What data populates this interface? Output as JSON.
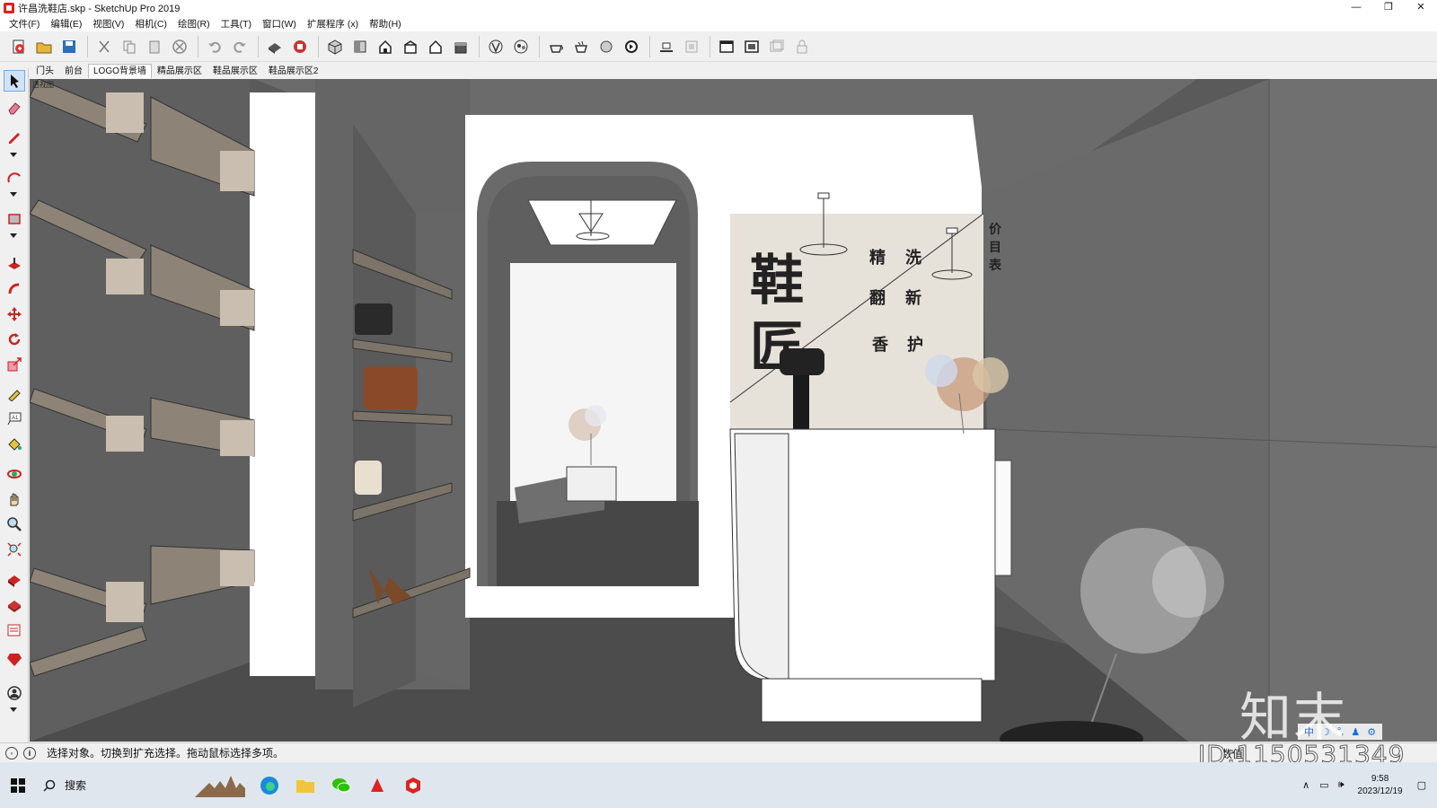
{
  "window": {
    "title": "许昌洗鞋店.skp - SketchUp Pro 2019",
    "controls": [
      "minimize",
      "restore",
      "close"
    ]
  },
  "menu": [
    "文件(F)",
    "编辑(E)",
    "视图(V)",
    "相机(C)",
    "绘图(R)",
    "工具(T)",
    "窗口(W)",
    "扩展程序 (x)",
    "帮助(H)"
  ],
  "toolbar_icons": [
    "new-file-icon",
    "open-folder-icon",
    "save-icon",
    "cut-icon",
    "copy-icon",
    "paste-icon",
    "erase-icon",
    "undo-icon",
    "redo-icon",
    "print-icon",
    "model-info-icon",
    "iso-view-icon",
    "top-view-icon",
    "front-view-icon",
    "right-view-icon",
    "back-view-icon",
    "left-view-icon",
    "xray-icon",
    "back-edges-icon",
    "wireframe-icon",
    "hidden-line-icon",
    "shaded-icon",
    "shaded-texture-icon",
    "section-plane-icon",
    "section-display-icon",
    "warehouse-icon",
    "extension-warehouse-icon",
    "layout-icon",
    "lock-icon"
  ],
  "scenes": {
    "tabs": [
      "门头",
      "前台",
      "LOGO背景墙",
      "精品展示区",
      "鞋品展示区",
      "鞋品展示区2"
    ],
    "active_index": 2
  },
  "viewport": {
    "view_label": "透视图",
    "sign": {
      "big_chars": [
        "鞋",
        "匠"
      ],
      "small_chars": [
        "精",
        "洗",
        "翻",
        "新",
        "香",
        "护"
      ],
      "side_text": "价目表"
    }
  },
  "left_tools": [
    "select-arrow-icon",
    "eraser-icon",
    "pencil-line-icon",
    "arc-icon",
    "rectangle-icon",
    "push-pull-icon",
    "follow-me-icon",
    "move-icon",
    "rotate-icon",
    "scale-icon",
    "tape-measure-icon",
    "text-icon",
    "paint-bucket-icon",
    "orbit-icon",
    "pan-icon",
    "zoom-icon",
    "zoom-extents-icon",
    "warehouse-3d-icon",
    "extension-icon",
    "layout-send-icon",
    "ruby-icon",
    "user-icon"
  ],
  "ime": [
    "中",
    "☽",
    "°,",
    "♟",
    "⚙"
  ],
  "status": {
    "message": "选择对象。切换到扩充选择。拖动鼠标选择多项。",
    "measurements_label": "数值"
  },
  "watermark": {
    "logo": "知末",
    "id": "ID:1150531349"
  },
  "taskbar": {
    "search_placeholder": "搜索",
    "time": "9:58",
    "date": "2023/12/19"
  }
}
